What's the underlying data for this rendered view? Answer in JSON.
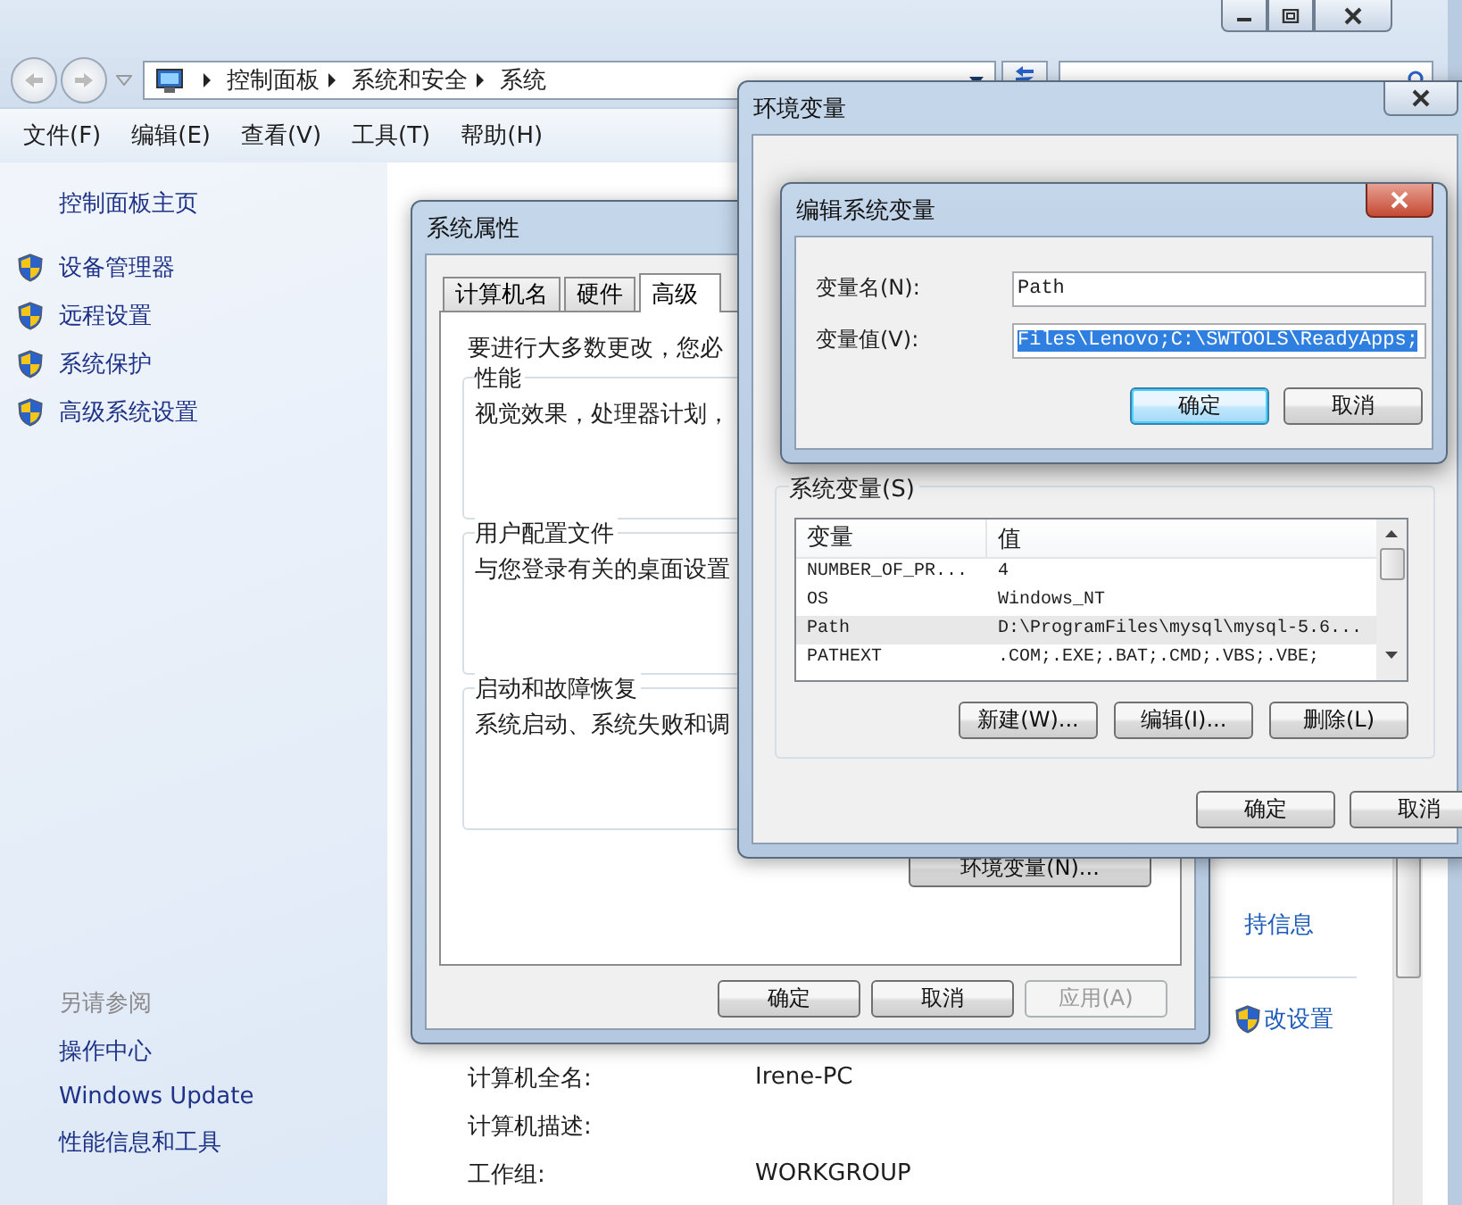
{
  "explorer": {
    "address": [
      "控制面板",
      "系统和安全",
      "系统"
    ],
    "menu": [
      "文件(F)",
      "编辑(E)",
      "查看(V)",
      "工具(T)",
      "帮助(H)"
    ],
    "sidebar": {
      "home": "控制面板主页",
      "tasks": [
        "设备管理器",
        "远程设置",
        "系统保护",
        "高级系统设置"
      ],
      "see_also_title": "另请参阅",
      "see_also": [
        "操作中心",
        "Windows Update",
        "性能信息和工具"
      ]
    },
    "links": [
      {
        "label": "持信息",
        "shield": false
      },
      {
        "label": "改设置",
        "shield": true
      }
    ],
    "details": [
      {
        "label": "计算机全名:",
        "value": "Irene-PC"
      },
      {
        "label": "计算机描述:"
      },
      {
        "label": "工作组:",
        "value": "WORKGROUP"
      }
    ]
  },
  "system_properties": {
    "title": "系统属性",
    "tabs": [
      {
        "label": "计算机名",
        "selected": false
      },
      {
        "label": "硬件",
        "selected": false
      },
      {
        "label": "高级",
        "selected": true
      }
    ],
    "intro": "要进行大多数更改，您必",
    "groups": [
      {
        "title": "性能",
        "text": "视觉效果，处理器计划，"
      },
      {
        "title": "用户配置文件",
        "text": "与您登录有关的桌面设置"
      },
      {
        "title": "启动和故障恢复",
        "text": "系统启动、系统失败和调"
      }
    ],
    "env_button": "环境变量(N)...",
    "buttons": [
      {
        "label": "确定",
        "disabled": false
      },
      {
        "label": "取消",
        "disabled": false
      },
      {
        "label": "应用(A)",
        "disabled": true
      }
    ]
  },
  "environment_variables": {
    "title": "环境变量",
    "system_group": "系统变量(S)",
    "columns": [
      "变量",
      "值"
    ],
    "rows": [
      {
        "name": "NUMBER_OF_PR...",
        "value": "4",
        "selected": false
      },
      {
        "name": "OS",
        "value": "Windows_NT",
        "selected": false
      },
      {
        "name": "Path",
        "value": "D:\\ProgramFiles\\mysql\\mysql-5.6...",
        "selected": true
      },
      {
        "name": "PATHEXT",
        "value": ".COM;.EXE;.BAT;.CMD;.VBS;.VBE;",
        "selected": false
      }
    ],
    "list_buttons": [
      "新建(W)...",
      "编辑(I)...",
      "删除(L)"
    ],
    "buttons": [
      "确定",
      "取消"
    ]
  },
  "edit_dialog": {
    "title": "编辑系统变量",
    "fields": [
      {
        "label": "变量名(N):",
        "value": "Path",
        "selected": false
      },
      {
        "label": "变量值(V):",
        "value": "Files\\Lenovo;C:\\SWTOOLS\\ReadyApps;",
        "selected": true
      }
    ],
    "buttons": [
      {
        "label": "确定",
        "default": true
      },
      {
        "label": "取消",
        "default": false
      }
    ]
  }
}
